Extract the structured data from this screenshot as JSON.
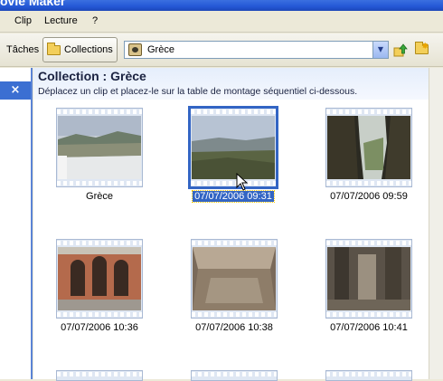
{
  "window": {
    "title": "ovie Maker"
  },
  "menu": {
    "items": [
      "Clip",
      "Lecture",
      "?"
    ]
  },
  "toolbar": {
    "taches_label": "Tâches",
    "collections_label": "Collections",
    "collection_select_value": "Grèce",
    "icons": [
      "up-folder-icon",
      "new-folder-icon"
    ]
  },
  "taskpane": {
    "close_label": "×"
  },
  "collection": {
    "title": "Collection : Grèce",
    "subtitle": "Déplacez un clip et placez-le sur la table de montage séquentiel ci-dessous."
  },
  "clips": [
    {
      "label": "Grèce"
    },
    {
      "label": "07/07/2006 09:31",
      "selected": true
    },
    {
      "label": "07/07/2006 09:59"
    },
    {
      "label": "07/07/2006 10:36"
    },
    {
      "label": "07/07/2006 10:38"
    },
    {
      "label": "07/07/2006 10:41"
    }
  ],
  "colors": {
    "accent": "#3365c4",
    "header_bg": "#e5eefc",
    "toolbar_bg": "#ece9d8"
  }
}
